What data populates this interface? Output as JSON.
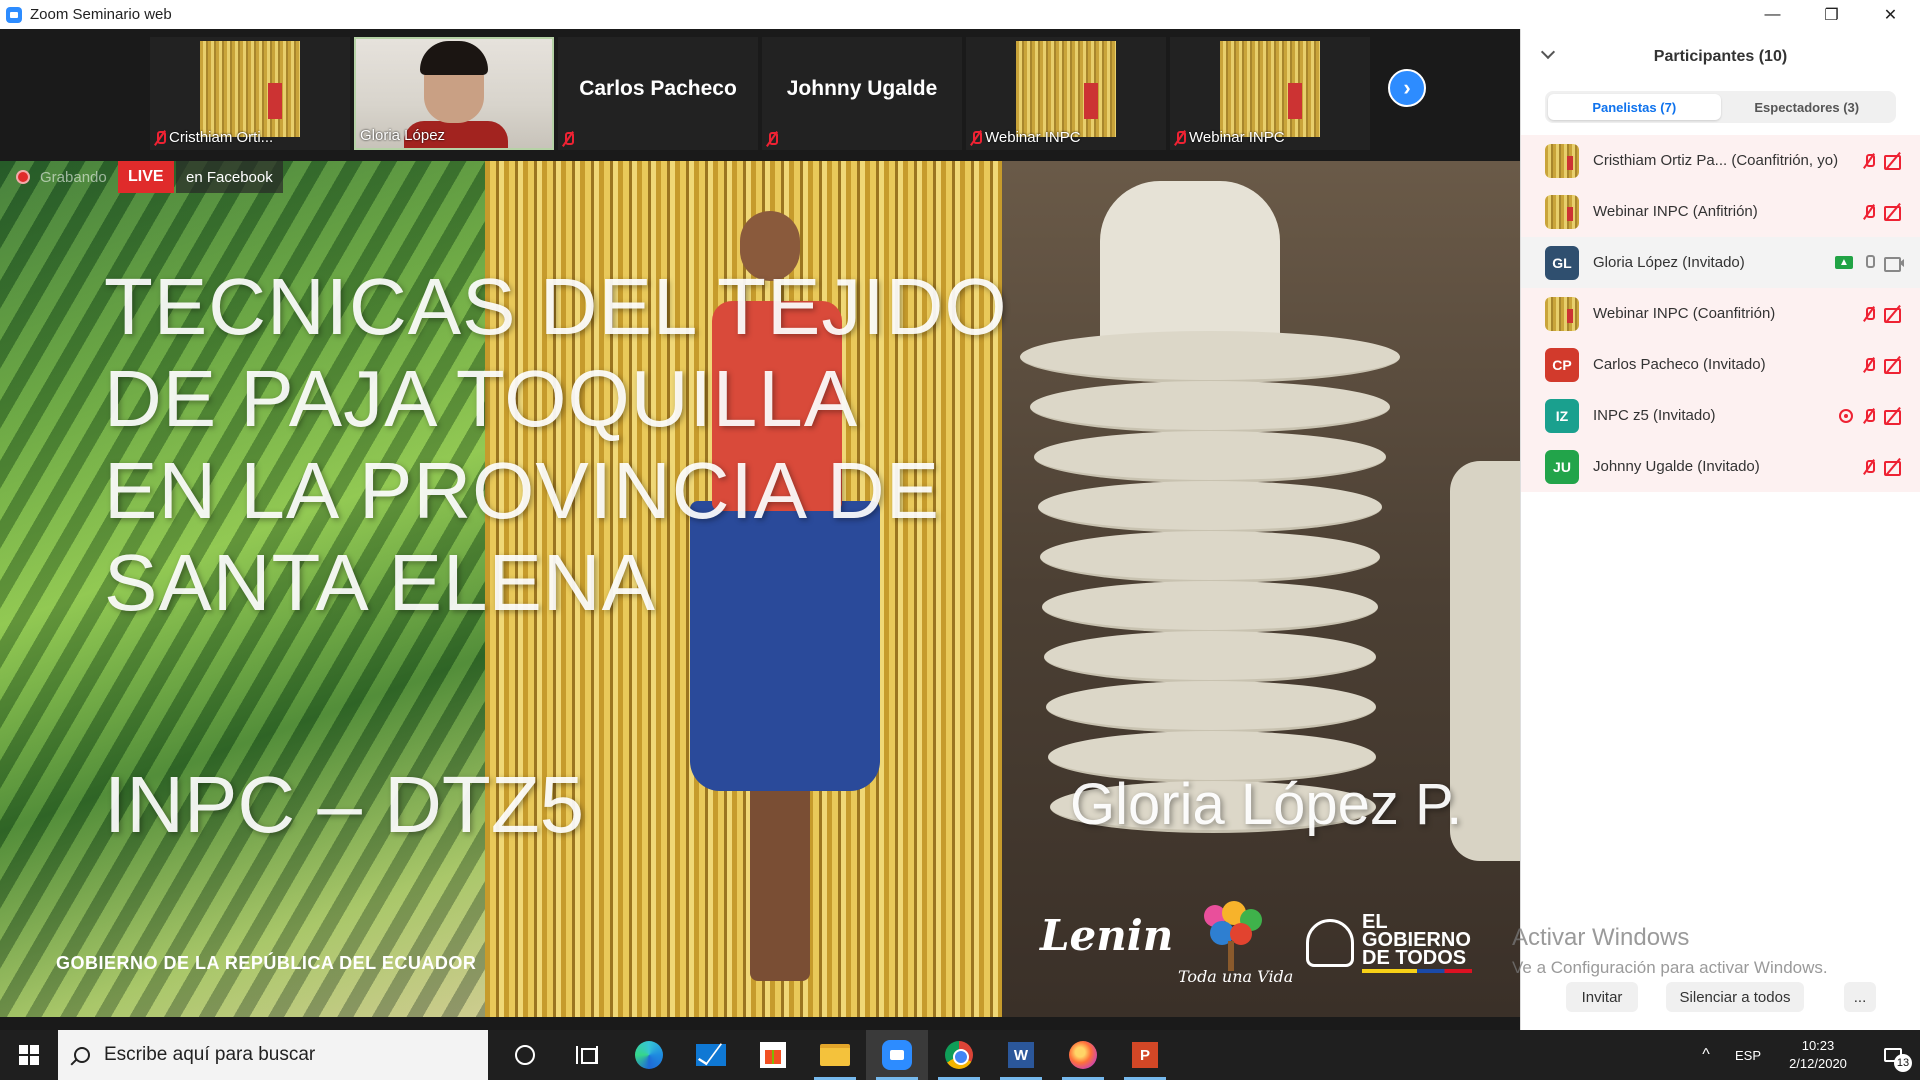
{
  "window": {
    "title": "Zoom Seminario web",
    "controls": {
      "minimize": "—",
      "restore": "❐",
      "close": "✕"
    }
  },
  "thumbnails": [
    {
      "name": "Cristhiam Orti...",
      "type": "image",
      "muted": true
    },
    {
      "name": "Gloria López",
      "type": "face",
      "muted": false,
      "active": true
    },
    {
      "name": "Carlos Pacheco",
      "type": "name",
      "muted": true
    },
    {
      "name": "Johnny Ugalde",
      "type": "name",
      "muted": true
    },
    {
      "name": "Webinar INPC",
      "type": "image",
      "muted": true
    },
    {
      "name": "Webinar INPC",
      "type": "image",
      "muted": true
    }
  ],
  "stage": {
    "recording_label": "Grabando",
    "live_label": "LIVE",
    "live_target": "en Facebook",
    "slide": {
      "title_lines": [
        "TECNICAS DEL TEJIDO",
        "DE PAJA TOQUILLA",
        "EN LA PROVINCIA DE",
        "SANTA ELENA"
      ],
      "org": "INPC – DTZ5",
      "author": "Gloria López P.",
      "gov_footer": "GOBIERNO DE LA REPÚBLICA DEL ECUADOR",
      "logo_lenin": "Lenin",
      "logo_tree_caption": "Toda una Vida",
      "logo_gov_lines": [
        "EL",
        "GOBIERNO",
        "DE TODOS"
      ]
    }
  },
  "panel": {
    "title": "Participantes (10)",
    "tabs": [
      {
        "label": "Panelistas (7)",
        "active": true
      },
      {
        "label": "Espectadores (3)",
        "active": false
      }
    ],
    "participants": [
      {
        "avatar": "image",
        "initials": "",
        "color": "",
        "name": "Cristhiam Ortiz Pa...  (Coanfitrión, yo)",
        "mic": "muted",
        "video": "muted",
        "extra": ""
      },
      {
        "avatar": "image",
        "initials": "",
        "color": "",
        "name": "Webinar INPC (Anfitrión)",
        "mic": "muted",
        "video": "muted",
        "extra": ""
      },
      {
        "avatar": "initials",
        "initials": "GL",
        "color": "#2f4f6f",
        "name": "Gloria López (Invitado)",
        "mic": "on",
        "video": "on",
        "extra": "share"
      },
      {
        "avatar": "image",
        "initials": "",
        "color": "",
        "name": "Webinar INPC (Coanfitrión)",
        "mic": "muted",
        "video": "muted",
        "extra": ""
      },
      {
        "avatar": "initials",
        "initials": "CP",
        "color": "#d23a2c",
        "name": "Carlos Pacheco (Invitado)",
        "mic": "muted",
        "video": "muted",
        "extra": ""
      },
      {
        "avatar": "initials",
        "initials": "IZ",
        "color": "#1aa08e",
        "name": "INPC z5 (Invitado)",
        "mic": "muted",
        "video": "muted",
        "extra": "record"
      },
      {
        "avatar": "initials",
        "initials": "JU",
        "color": "#22a44a",
        "name": "Johnny Ugalde  (Invitado)",
        "mic": "muted",
        "video": "muted",
        "extra": ""
      }
    ],
    "watermark_title": "Activar Windows",
    "watermark_sub": "Ve a Configuración para activar Windows.",
    "buttons": {
      "invite": "Invitar",
      "mute_all": "Silenciar a todos",
      "more": "..."
    }
  },
  "taskbar": {
    "search_placeholder": "Escribe aquí para buscar",
    "apps": [
      "cortana",
      "task-view",
      "edge",
      "mail",
      "store",
      "file-explorer",
      "zoom",
      "chrome",
      "word",
      "firefox",
      "powerpoint"
    ],
    "tray": {
      "chevron": "^",
      "language": "ESP",
      "time": "10:23",
      "date": "2/12/2020",
      "notifications": "13"
    }
  }
}
